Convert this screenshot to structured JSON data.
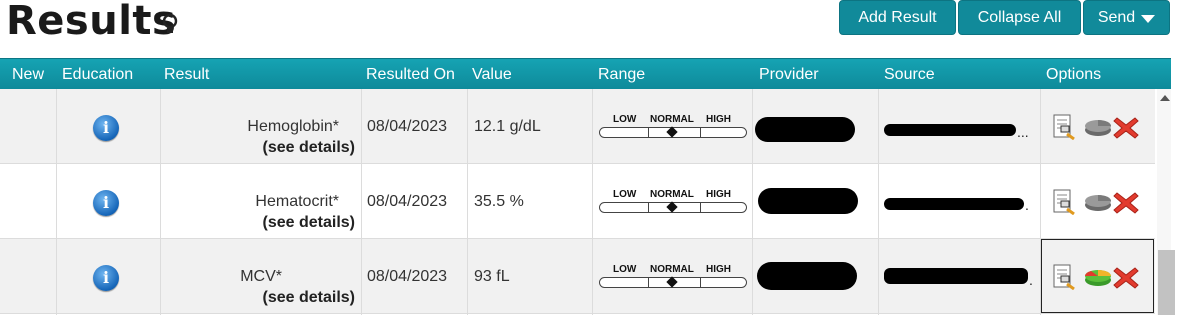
{
  "page": {
    "title": "Results",
    "hint_icon": "lightbulb-icon"
  },
  "toolbar": {
    "add_result": "Add Result",
    "collapse_all": "Collapse All",
    "send": "Send"
  },
  "table": {
    "columns": [
      "New",
      "Education",
      "Result",
      "Resulted On",
      "Value",
      "Range",
      "Provider",
      "Source",
      "Options"
    ],
    "range_labels": {
      "low": "LOW",
      "normal": "NORMAL",
      "high": "HIGH"
    },
    "rows": [
      {
        "name": "Hemoglobin*",
        "details": "(see details)",
        "date": "08/04/2023",
        "value": "12.1 g/dL",
        "range_marker": "normal",
        "source_suffix": "...",
        "options_selected": false
      },
      {
        "name": "Hematocrit*",
        "details": "(see details)",
        "date": "08/04/2023",
        "value": "35.5 %",
        "range_marker": "normal",
        "source_suffix": ".",
        "options_selected": false
      },
      {
        "name": "MCV*",
        "details": "(see details)",
        "date": "08/04/2023",
        "value": "93 fL",
        "range_marker": "normal",
        "source_suffix": ".",
        "options_selected": true
      }
    ]
  },
  "colors": {
    "header": "#118a9a",
    "button": "#118a9a",
    "row_alt": "#f1f1f1",
    "delete": "#e23b2e",
    "pie_active": "#f0b429",
    "pie_active2": "#5bbf3a"
  }
}
